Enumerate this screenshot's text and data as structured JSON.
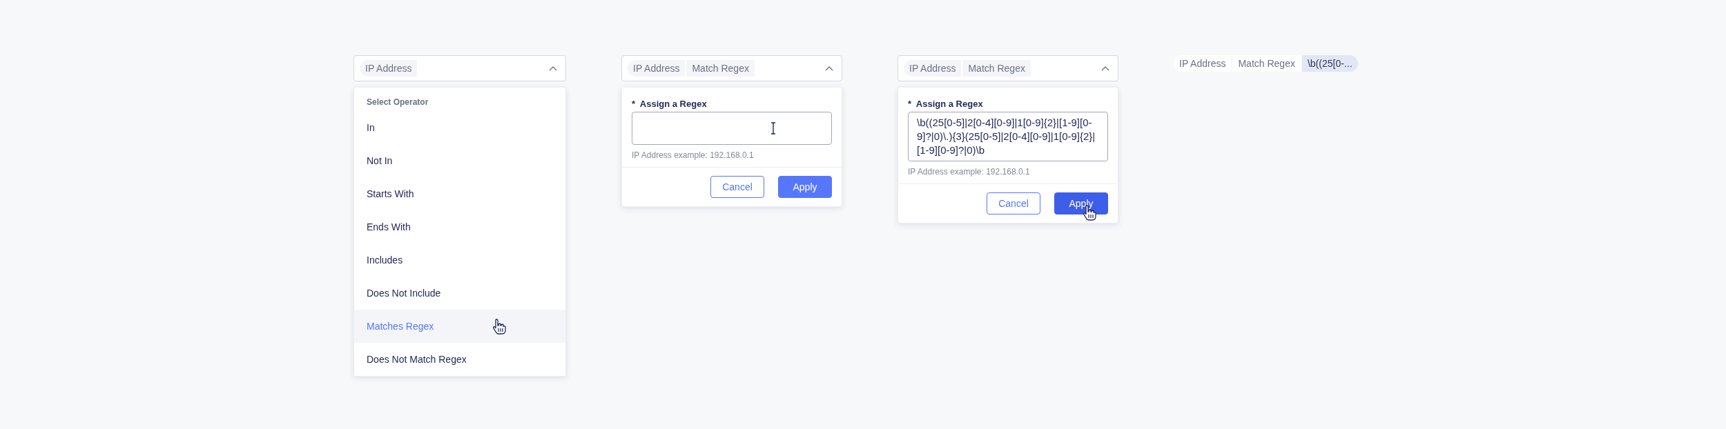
{
  "filter_states": [
    {
      "kind": "operator_menu",
      "expanded": true,
      "chips": [
        {
          "label": "IP Address",
          "active": false
        }
      ],
      "menu": {
        "heading": "Select Operator",
        "items": [
          {
            "label": "In",
            "selected": false
          },
          {
            "label": "Not In",
            "selected": false
          },
          {
            "label": "Starts With",
            "selected": false
          },
          {
            "label": "Ends With",
            "selected": false
          },
          {
            "label": "Includes",
            "selected": false
          },
          {
            "label": "Does Not Include",
            "selected": false
          },
          {
            "label": "Matches Regex",
            "selected": true
          },
          {
            "label": "Does Not Match Regex",
            "selected": false
          }
        ]
      }
    },
    {
      "kind": "regex_form",
      "expanded": true,
      "chips": [
        {
          "label": "IP Address",
          "active": false
        },
        {
          "label": "Match Regex",
          "active": false
        }
      ],
      "required_mark": "*",
      "label": "Assign a Regex",
      "hint": "IP Address example: 192.168.0.1",
      "buttons": [
        {
          "label": "Cancel",
          "kind": "secondary",
          "hovered": false
        },
        {
          "label": "Apply",
          "kind": "primary",
          "hovered": false
        }
      ]
    },
    {
      "kind": "regex_form",
      "expanded": true,
      "chips": [
        {
          "label": "IP Address",
          "active": false
        },
        {
          "label": "Match Regex",
          "active": false
        }
      ],
      "required_mark": "*",
      "label": "Assign a Regex",
      "value": "\\b((25[0-5]|2[0-4][0-9]|1[0-9]{2}|[1-9][0-9]?|0)\\.){3}(25[0-5]|2[0-4][0-9]|1[0-9]{2}|[1-9][0-9]?|0)\\b",
      "hint": "IP Address example: 192.168.0.1",
      "buttons": [
        {
          "label": "Cancel",
          "kind": "secondary",
          "hovered": false
        },
        {
          "label": "Apply",
          "kind": "primary",
          "hovered": true
        }
      ]
    },
    {
      "kind": "applied",
      "chips": [
        {
          "label": "IP Address",
          "active": false
        },
        {
          "label": "Match Regex",
          "active": false
        },
        {
          "label": "\\b((25[0-...",
          "active": true
        }
      ]
    }
  ]
}
